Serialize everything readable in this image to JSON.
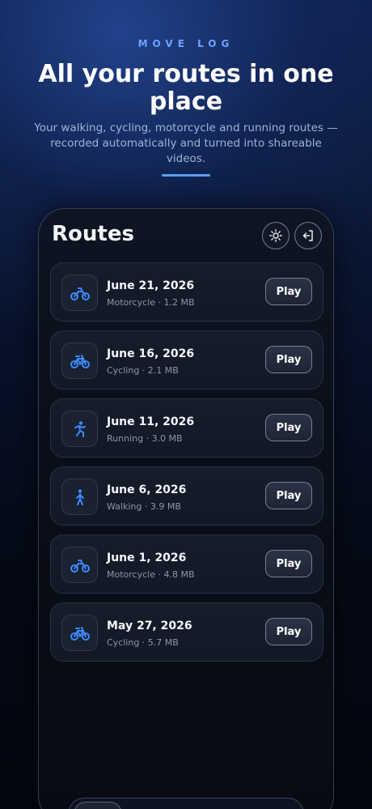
{
  "header": {
    "eyebrow": "MOVE LOG",
    "headline": "All your routes in one place",
    "subtitle": "Your walking, cycling, motorcycle and running routes — recorded automatically and turned into shareable videos."
  },
  "app": {
    "title": "Routes",
    "actions": [
      {
        "name": "theme-toggle",
        "icon": "sun-icon"
      },
      {
        "name": "logout",
        "icon": "logout-icon"
      }
    ]
  },
  "routes": [
    {
      "date": "June 21, 2026",
      "meta": "Motorcycle · 1.2 MB",
      "icon": "motorcycle-icon",
      "play": "Play"
    },
    {
      "date": "June 16, 2026",
      "meta": "Cycling · 2.1 MB",
      "icon": "bicycle-icon",
      "play": "Play"
    },
    {
      "date": "June 11, 2026",
      "meta": "Running · 3.0 MB",
      "icon": "running-icon",
      "play": "Play"
    },
    {
      "date": "June 6, 2026",
      "meta": "Walking · 3.9 MB",
      "icon": "walking-icon",
      "play": "Play"
    },
    {
      "date": "June 1, 2026",
      "meta": "Motorcycle · 4.8 MB",
      "icon": "motorcycle-icon",
      "play": "Play"
    },
    {
      "date": "May 27, 2026",
      "meta": "Cycling · 5.7 MB",
      "icon": "bicycle-icon",
      "play": "Play"
    }
  ],
  "colors": {
    "accent": "#5aa0ff",
    "eyebrow": "#6ea3ff",
    "icon": "#3d8bff"
  }
}
